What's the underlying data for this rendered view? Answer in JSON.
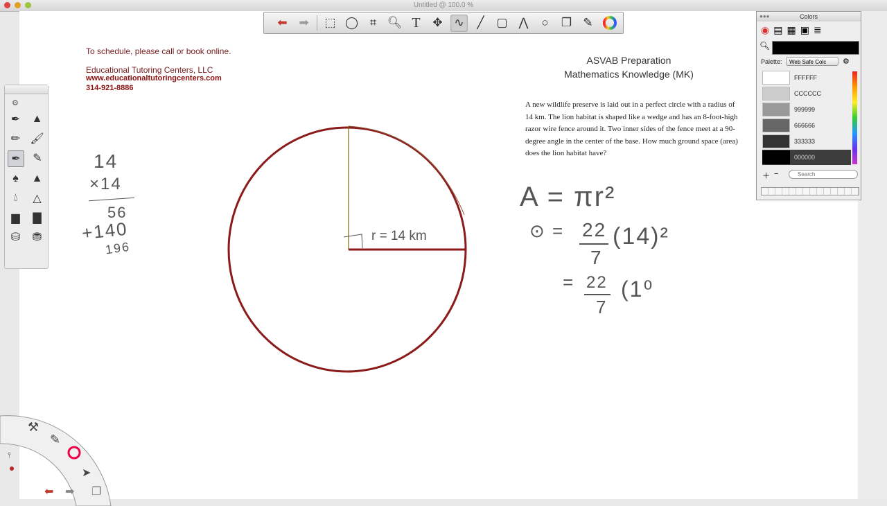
{
  "window": {
    "title": "Untitled @ 100.0 %"
  },
  "toolbar": {
    "tools": [
      "undo-icon",
      "redo-icon",
      "rect-select-icon",
      "lasso-icon",
      "crop-icon",
      "zoom-icon",
      "text-icon",
      "move-icon",
      "pen-icon",
      "line-icon",
      "rectangle-icon",
      "polyline-icon",
      "ellipse-icon",
      "layers-icon",
      "brush-tool-icon",
      "color-wheel-icon"
    ]
  },
  "header": {
    "schedule": "To schedule, please call or book online.",
    "company": "Educational Tutoring Centers, LLC",
    "website": "www.educationaltutoringcenters.com",
    "phone": "314-921-8886"
  },
  "asvab": {
    "line1": "ASVAB Preparation",
    "line2": "Mathematics Knowledge (MK)"
  },
  "problem": {
    "text": "A new wildlife preserve is laid out in a perfect circle with a radius of 14 km. The lion habitat is shaped like a wedge and has an 8-foot-high razor wire fence around it. Two inner sides of the fence meet at a 90-degree angle in the center of the base. How much ground space (area) does the lion habitat have?"
  },
  "handwriting": {
    "mult_top": "14",
    "mult_by": "×14",
    "partial1": "56",
    "partial2": "+140",
    "result": "196",
    "radius_label": "r = 14 km",
    "formula": "A = πr²",
    "step1_lhs": "⊙ =",
    "step1_num": "22",
    "step1_den": "7",
    "step1_paren": "(14)²",
    "step2_eq": "=",
    "step2_num": "22",
    "step2_den": "7",
    "step2_paren": "(1⁰"
  },
  "colors_panel": {
    "title": "Colors",
    "palette_label": "Palette:",
    "palette_value": "Web Safe Colc",
    "search_placeholder": "Search",
    "swatches": [
      {
        "name": "FFFFFF",
        "color": "#FFFFFF"
      },
      {
        "name": "CCCCCC",
        "color": "#CCCCCC"
      },
      {
        "name": "999999",
        "color": "#999999"
      },
      {
        "name": "666666",
        "color": "#666666"
      },
      {
        "name": "333333",
        "color": "#333333"
      },
      {
        "name": "000000",
        "color": "#000000"
      }
    ]
  },
  "style": {
    "ink_red": "#8b1a1a",
    "ink_gray": "#555555"
  }
}
